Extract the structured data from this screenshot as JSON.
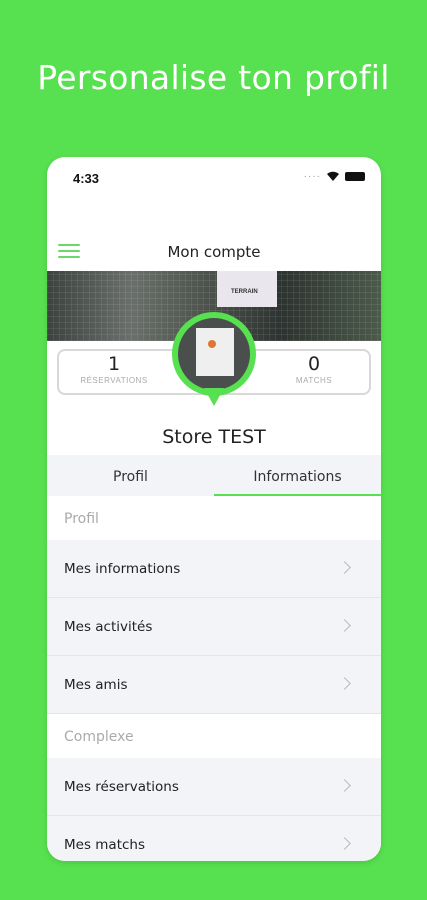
{
  "headline": "Personalise ton profil",
  "status": {
    "time": "4:33"
  },
  "appbar": {
    "title": "Mon compte"
  },
  "stats": {
    "reservations": {
      "value": "1",
      "label": "RÉSERVATIONS"
    },
    "matches": {
      "value": "0",
      "label": "MATCHS"
    }
  },
  "cover": {
    "sign_text": "TERRAIN"
  },
  "profile": {
    "name": "Store TEST"
  },
  "tabs": [
    {
      "label": "Profil",
      "active": false
    },
    {
      "label": "Informations",
      "active": true
    }
  ],
  "sections": {
    "profil": {
      "header": "Profil",
      "items": [
        "Mes informations",
        "Mes activités",
        "Mes amis"
      ]
    },
    "complexe": {
      "header": "Complexe",
      "items": [
        "Mes réservations",
        "Mes matchs"
      ]
    }
  },
  "colors": {
    "accent": "#57e04f",
    "background": "#57e04f"
  }
}
